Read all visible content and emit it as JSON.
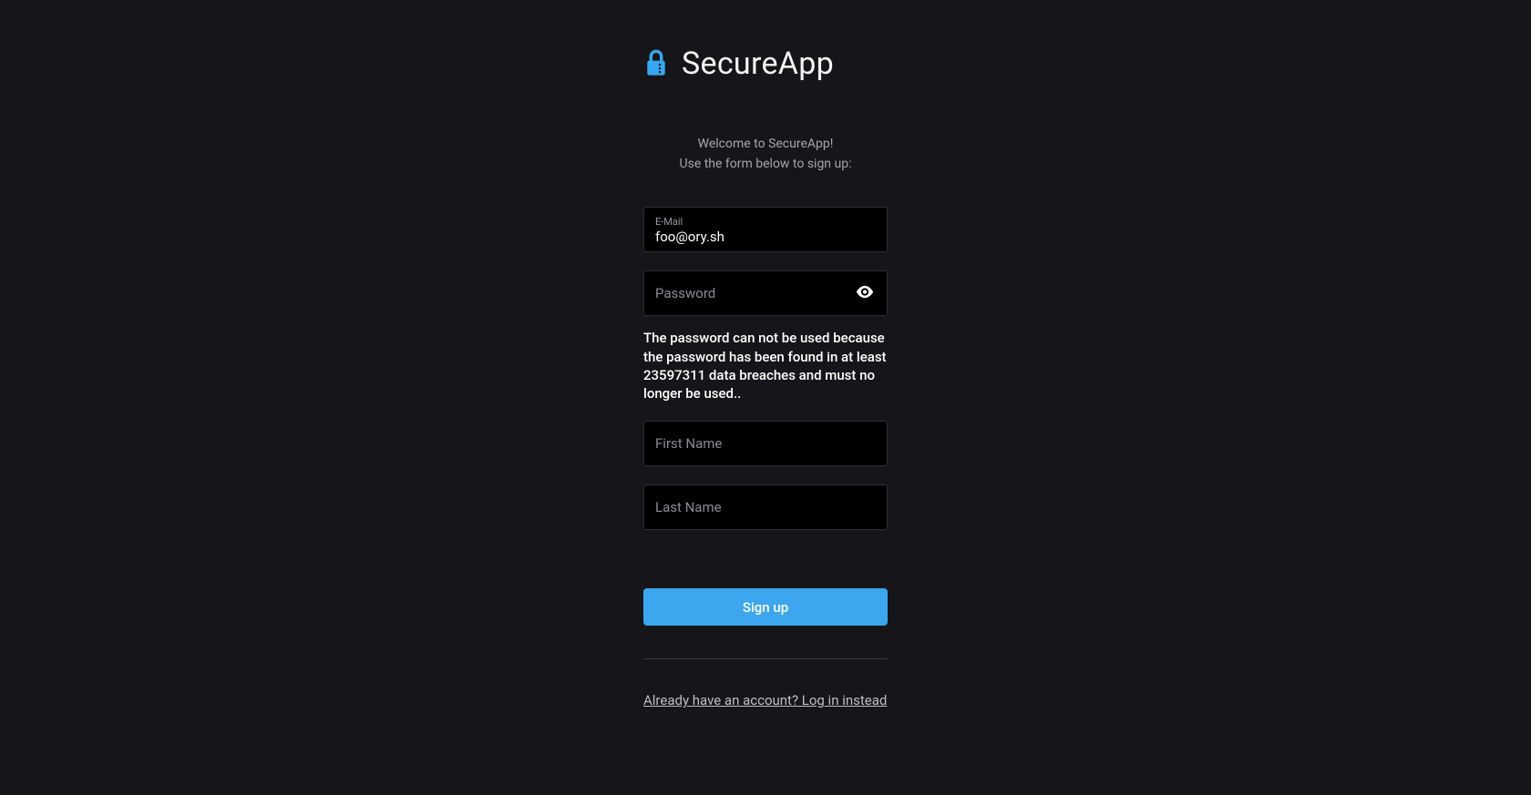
{
  "app": {
    "title": "SecureApp"
  },
  "intro": {
    "line1": "Welcome to SecureApp!",
    "line2": "Use the form below to sign up:"
  },
  "fields": {
    "email": {
      "label": "E-Mail",
      "value": "foo@ory.sh"
    },
    "password": {
      "placeholder": "Password",
      "value": "",
      "error": "The password can not be used because the password has been found in at least 23597311 data breaches and must no longer be used.."
    },
    "first_name": {
      "placeholder": "First Name",
      "value": ""
    },
    "last_name": {
      "placeholder": "Last Name",
      "value": ""
    }
  },
  "actions": {
    "submit_label": "Sign up",
    "login_link": "Already have an account? Log in instead"
  },
  "colors": {
    "background": "#16161a",
    "field_bg": "#000000",
    "accent": "#3ca6ee",
    "lock_icon": "#37a8ef"
  }
}
